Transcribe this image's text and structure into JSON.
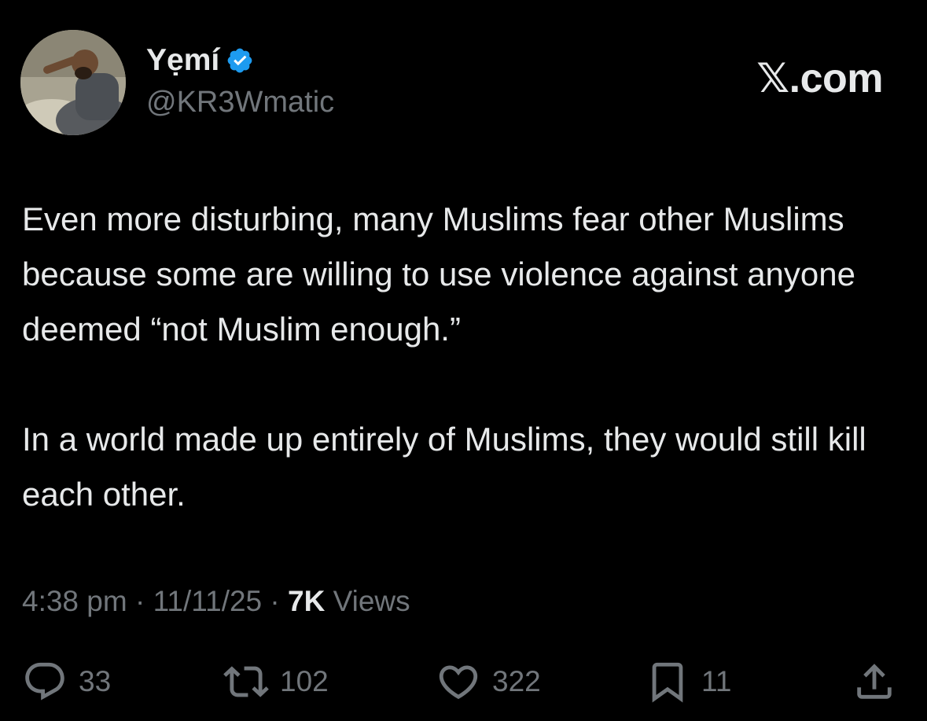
{
  "header": {
    "display_name": "Yẹmí",
    "handle": "@KR3Wmatic",
    "brand": "𝕏.com",
    "verified_color": "#1d9bf0"
  },
  "tweet": {
    "paragraphs": [
      "Even more disturbing, many Muslims fear other Muslims because some are willing to use violence against anyone deemed “not Muslim enough.”",
      "In a world made up entirely of Muslims, they would still kill each other."
    ]
  },
  "meta": {
    "time": "4:38 pm",
    "separator": " · ",
    "date": "11/11/25",
    "views_count": "7K",
    "views_label": " Views"
  },
  "actions": {
    "replies": "33",
    "reposts": "102",
    "likes": "322",
    "bookmarks": "11"
  },
  "icons": {
    "reply": "reply-icon",
    "repost": "repost-icon",
    "like": "like-icon",
    "bookmark": "bookmark-icon",
    "share": "share-icon",
    "verified": "verified-badge-icon"
  },
  "colors": {
    "background": "#000000",
    "text_primary": "#e7e9ea",
    "text_secondary": "#71767b"
  }
}
